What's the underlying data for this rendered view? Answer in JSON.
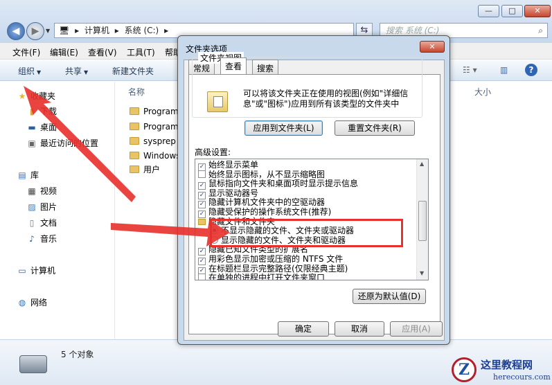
{
  "window": {
    "close_glyph": "✕",
    "min_glyph": "—",
    "max_glyph": "□"
  },
  "address": {
    "crumbs": [
      "计算机",
      "系统 (C:)"
    ],
    "search_placeholder": "搜索 系统 (C:)"
  },
  "menu": [
    "文件(F)",
    "编辑(E)",
    "查看(V)",
    "工具(T)",
    "帮助"
  ],
  "toolbar": {
    "organize": "组织",
    "share": "共享",
    "new_folder": "新建文件夹"
  },
  "sidebar": {
    "favorites": "收藏夹",
    "downloads": "下载",
    "desktop": "桌面",
    "recent": "最近访问的位置",
    "libraries": "库",
    "videos": "视频",
    "pictures": "图片",
    "documents": "文档",
    "music": "音乐",
    "computer": "计算机",
    "network": "网络"
  },
  "content": {
    "name_header": "名称",
    "size_header": "大小",
    "files": [
      "Program",
      "Program",
      "sysprep",
      "Windows",
      "用户"
    ]
  },
  "status": {
    "count": "5 个对象"
  },
  "dialog": {
    "title": "文件夹选项",
    "close_glyph": "✕",
    "tabs": [
      "常规",
      "查看",
      "搜索"
    ],
    "folder_views_title": "文件夹视图",
    "folder_views_desc": "可以将该文件夹正在使用的视图(例如\"详细信息\"或\"图标\")应用到所有该类型的文件夹中",
    "apply_to_folders": "应用到文件夹(L)",
    "reset_folders": "重置文件夹(R)",
    "advanced_label": "高级设置:",
    "options": [
      {
        "label": "始终显示菜单",
        "type": "checkbox",
        "checked": true
      },
      {
        "label": "始终显示图标，从不显示缩略图",
        "type": "checkbox",
        "checked": false
      },
      {
        "label": "鼠标指向文件夹和桌面项时显示提示信息",
        "type": "checkbox",
        "checked": true
      },
      {
        "label": "显示驱动器号",
        "type": "checkbox",
        "checked": true
      },
      {
        "label": "隐藏计算机文件夹中的空驱动器",
        "type": "checkbox",
        "checked": true
      },
      {
        "label": "隐藏受保护的操作系统文件(推荐)",
        "type": "checkbox",
        "checked": true
      },
      {
        "label": "隐藏文件和文件夹",
        "type": "folder",
        "checked": false
      },
      {
        "label": "不显示隐藏的文件、文件夹或驱动器",
        "type": "radio",
        "checked": true
      },
      {
        "label": "显示隐藏的文件、文件夹和驱动器",
        "type": "radio",
        "checked": false
      },
      {
        "label": "隐藏已知文件类型的扩展名",
        "type": "checkbox",
        "checked": true
      },
      {
        "label": "用彩色显示加密或压缩的 NTFS 文件",
        "type": "checkbox",
        "checked": true
      },
      {
        "label": "在标题栏显示完整路径(仅限经典主题)",
        "type": "checkbox",
        "checked": true
      },
      {
        "label": "在单独的进程中打开文件夹窗口",
        "type": "checkbox",
        "checked": false
      }
    ],
    "restore_defaults": "还原为默认值(D)",
    "ok": "确定",
    "cancel": "取消",
    "apply": "应用(A)"
  },
  "watermark": {
    "logo_letter": "Z",
    "name": "这里教程网",
    "url": "herecours.com"
  },
  "colors": {
    "annotation_red": "#e8302c",
    "dialog_frame": "#c9d9ec"
  }
}
